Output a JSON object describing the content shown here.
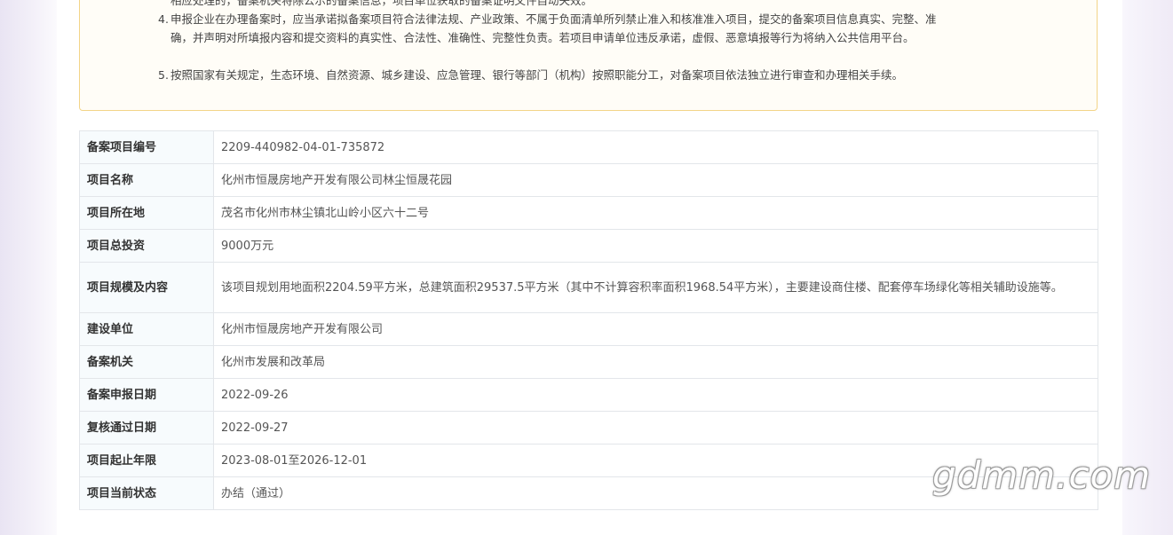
{
  "notice": {
    "item3_tail": "相应处理的，备案机关将除公示的备案信息，项目单位获取的备案证明文件自动失效。",
    "item4": {
      "num": "4.",
      "text": "申报企业在办理备案时，应当承诺拟备案项目符合法律法规、产业政策、不属于负面清单所列禁止准入和核准准入项目，提交的备案项目信息真实、完整、准确，并声明对所填报内容和提交资料的真实性、合法性、准确性、完整性负责。若项目申请单位违反承诺，虚假、恶意填报等行为将纳入公共信用平台。"
    },
    "item5": {
      "num": "5.",
      "text": "按照国家有关规定，生态环境、自然资源、城乡建设、应急管理、银行等部门（机构）按照职能分工，对备案项目依法独立进行审查和办理相关手续。"
    }
  },
  "project": {
    "rows": [
      {
        "label": "备案项目编号",
        "value": "2209-440982-04-01-735872"
      },
      {
        "label": "项目名称",
        "value": "化州市恒晟房地产开发有限公司林尘恒晟花园"
      },
      {
        "label": "项目所在地",
        "value": "茂名市化州市林尘镇北山岭小区六十二号"
      },
      {
        "label": "项目总投资",
        "value": "9000万元"
      },
      {
        "label": "项目规模及内容",
        "value": "该项目规划用地面积2204.59平方米，总建筑面积29537.5平方米（其中不计算容积率面积1968.54平方米），主要建设商住楼、配套停车场绿化等相关辅助设施等。"
      },
      {
        "label": "建设单位",
        "value": "化州市恒晟房地产开发有限公司"
      },
      {
        "label": "备案机关",
        "value": "化州市发展和改革局"
      },
      {
        "label": "备案申报日期",
        "value": "2022-09-26"
      },
      {
        "label": "复核通过日期",
        "value": "2022-09-27"
      },
      {
        "label": "项目起止年限",
        "value": "2023-08-01至2026-12-01"
      },
      {
        "label": "项目当前状态",
        "value": "办结（通过）"
      }
    ]
  },
  "watermark": {
    "text": "gdmm.com"
  },
  "colors": {
    "notice_border": "#f3d488",
    "label_bg": "#f7fbfd",
    "table_border": "#e3e6ea"
  }
}
